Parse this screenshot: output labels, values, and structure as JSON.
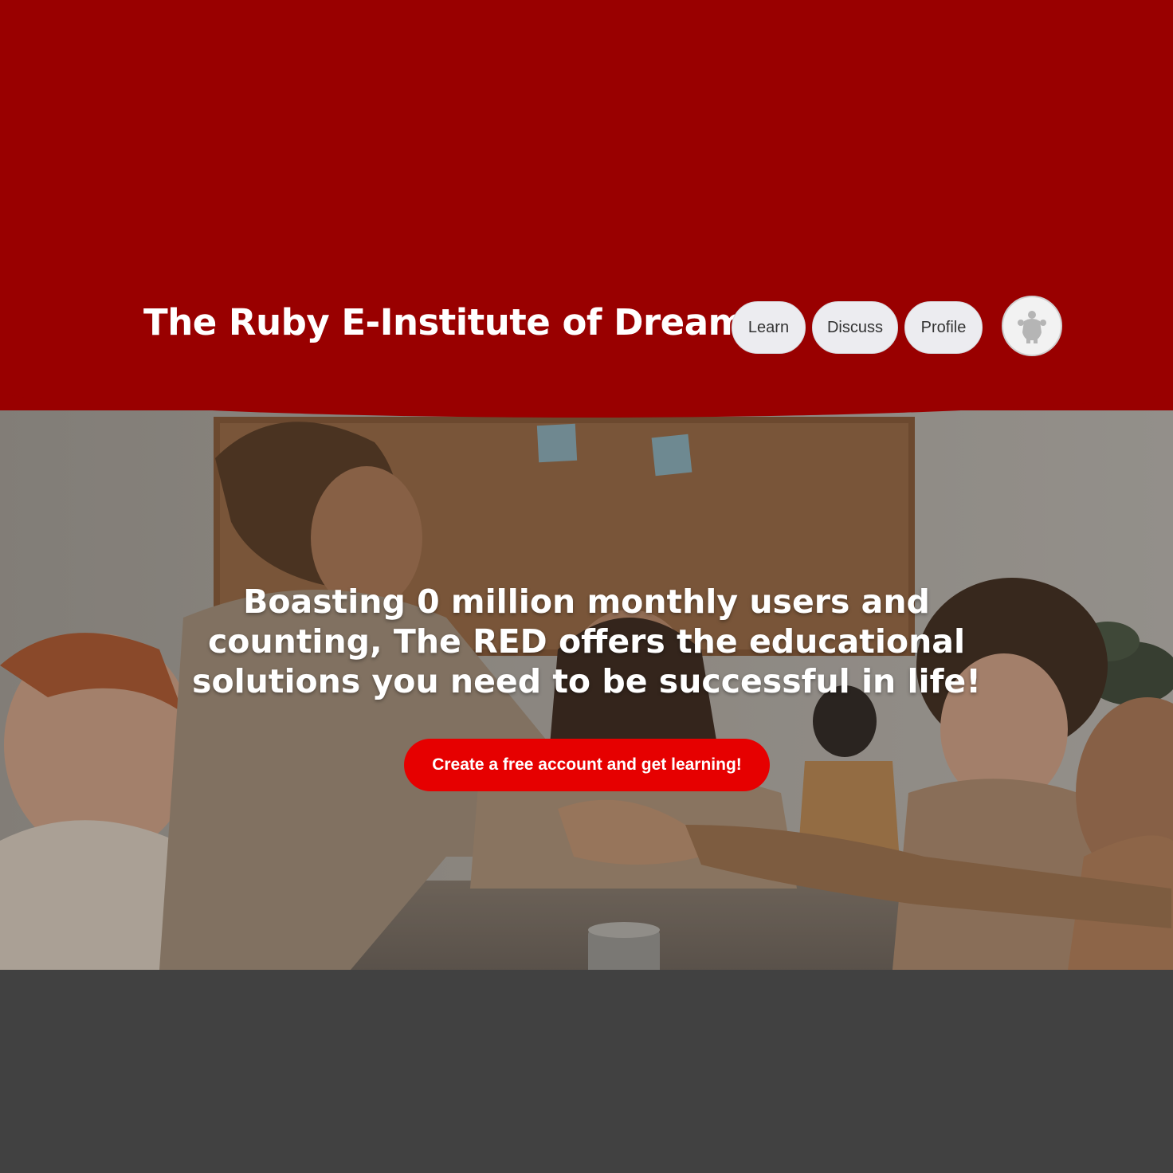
{
  "header": {
    "title": "The Ruby E-Institute of Dreams",
    "background_color": "#990000",
    "nav": [
      {
        "label": "Learn"
      },
      {
        "label": "Discuss"
      },
      {
        "label": "Profile"
      }
    ],
    "avatar_icon": "user-silhouette-icon"
  },
  "hero": {
    "headline": "Boasting 0 million monthly users and counting, The RED offers the educational solutions you need to be successful in life!",
    "cta_label": "Create a free account and get learning!",
    "cta_color": "#e60000",
    "image_description_icon": "team-handshake-photo"
  },
  "footer": {
    "background_color": "#414141"
  }
}
